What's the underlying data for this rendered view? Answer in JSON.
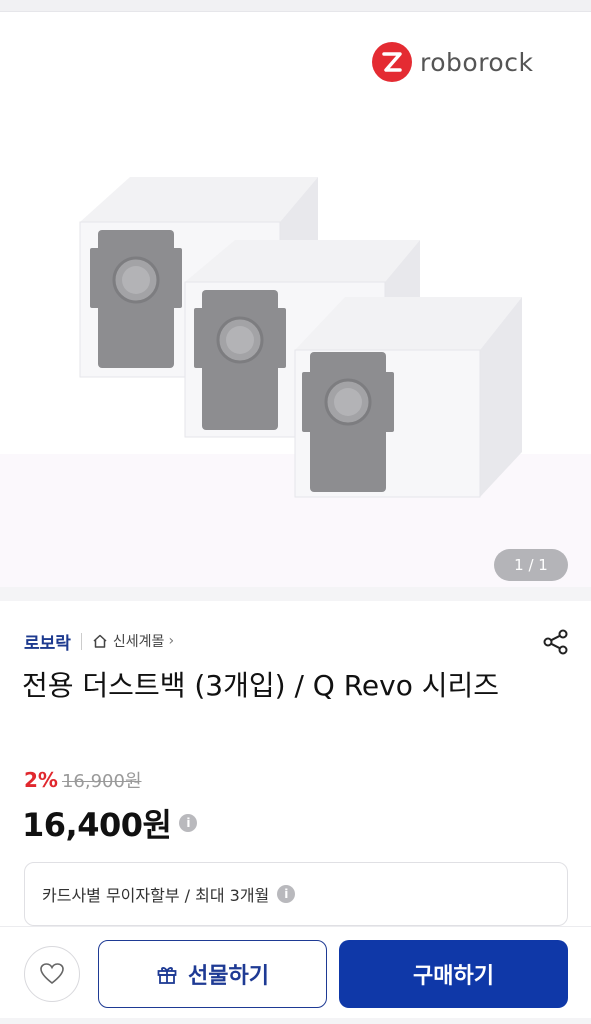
{
  "hero": {
    "brand_name": "roborock",
    "brand_color": "#e42b32",
    "counter": "1 / 1"
  },
  "meta": {
    "brand": "로보락",
    "mall": "신세계몰",
    "mall_icon": "home-icon",
    "share_icon": "share-icon"
  },
  "product": {
    "title": "전용 더스트백 (3개입) / Q Revo 시리즈",
    "discount": "2%",
    "original_price": "16,900원",
    "price": "16,400원",
    "info_icon": "i"
  },
  "installment": {
    "text": "카드사별 무이자할부 / 최대 3개월",
    "info_icon": "i"
  },
  "actions": {
    "wishlist_icon": "heart-icon",
    "gift_label": "선물하기",
    "buy_label": "구매하기",
    "accent": "#0f38a8"
  }
}
